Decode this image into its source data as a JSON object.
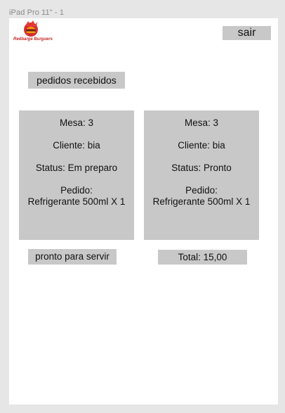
{
  "frame": {
    "label": "iPad Pro 11\" - 1"
  },
  "brand": {
    "logo_text": "Redbarge Burguers",
    "colors": {
      "logo_red": "#d32f2f",
      "logo_orange": "#f59e0b"
    }
  },
  "header": {
    "logout_label": "sair"
  },
  "section": {
    "title": "pedidos recebidos"
  },
  "orders": [
    {
      "mesa": "Mesa: 3",
      "cliente": "Cliente: bia",
      "status": "Status: Em preparo",
      "pedido_label": "Pedido:",
      "item": "Refrigerante 500ml X 1"
    },
    {
      "mesa": "Mesa: 3",
      "cliente": "Cliente: bia",
      "status": "Status: Pronto",
      "pedido_label": "Pedido:",
      "item": "Refrigerante 500ml X 1"
    }
  ],
  "actions": {
    "ready_label": "pronto para servir",
    "total_label": "Total: 15,00"
  },
  "colors": {
    "background": "#e6e6e6",
    "canvas": "#ffffff",
    "box": "#c8c8c8"
  }
}
